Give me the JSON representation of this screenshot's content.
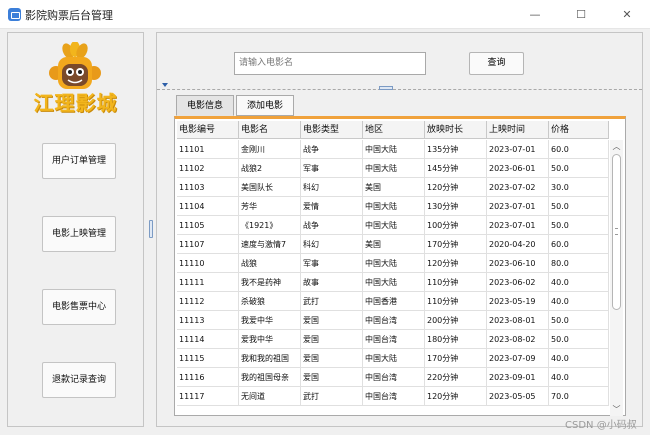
{
  "window": {
    "title": "影院购票后台管理",
    "minimize_glyph": "—",
    "maximize_glyph": "☐",
    "close_glyph": "✕"
  },
  "sidebar": {
    "logo_text": "江理影城",
    "items": [
      {
        "label": "用户订单管理"
      },
      {
        "label": "电影上映管理"
      },
      {
        "label": "电影售票中心"
      },
      {
        "label": "退款记录查询"
      }
    ]
  },
  "search": {
    "placeholder": "请输入电影名",
    "button_label": "查询"
  },
  "tabs": [
    {
      "label": "电影信息"
    },
    {
      "label": "添加电影"
    }
  ],
  "table": {
    "columns": [
      "电影编号",
      "电影名",
      "电影类型",
      "地区",
      "放映时长",
      "上映时间",
      "价格"
    ],
    "rows": [
      [
        "11101",
        "金刚川",
        "战争",
        "中国大陆",
        "135分钟",
        "2023-07-01",
        "60.0"
      ],
      [
        "11102",
        "战狼2",
        "军事",
        "中国大陆",
        "145分钟",
        "2023-06-01",
        "50.0"
      ],
      [
        "11103",
        "美国队长",
        "科幻",
        "美国",
        "120分钟",
        "2023-07-02",
        "30.0"
      ],
      [
        "11104",
        "芳华",
        "爱情",
        "中国大陆",
        "130分钟",
        "2023-07-01",
        "50.0"
      ],
      [
        "11105",
        "《1921》",
        "战争",
        "中国大陆",
        "100分钟",
        "2023-07-01",
        "50.0"
      ],
      [
        "11107",
        "速度与激情7",
        "科幻",
        "美国",
        "170分钟",
        "2020-04-20",
        "60.0"
      ],
      [
        "11110",
        "战狼",
        "军事",
        "中国大陆",
        "120分钟",
        "2023-06-10",
        "80.0"
      ],
      [
        "11111",
        "我不是药神",
        "故事",
        "中国大陆",
        "110分钟",
        "2023-06-02",
        "40.0"
      ],
      [
        "11112",
        "杀破狼",
        "武打",
        "中国香港",
        "110分钟",
        "2023-05-19",
        "40.0"
      ],
      [
        "11113",
        "我爱中华",
        "爱国",
        "中国台湾",
        "200分钟",
        "2023-08-01",
        "50.0"
      ],
      [
        "11114",
        "爱我中华",
        "爱国",
        "中国台湾",
        "180分钟",
        "2023-08-02",
        "50.0"
      ],
      [
        "11115",
        "我和我的祖国",
        "爱国",
        "中国大陆",
        "170分钟",
        "2023-07-09",
        "40.0"
      ],
      [
        "11116",
        "我的祖国母亲",
        "爱国",
        "中国台湾",
        "220分钟",
        "2023-09-01",
        "40.0"
      ],
      [
        "11117",
        "无间道",
        "武打",
        "中国台湾",
        "120分钟",
        "2023-05-05",
        "70.0"
      ]
    ]
  },
  "watermark": "CSDN @小码叔",
  "colors": {
    "logo": "#f2b51c",
    "tab_accent": "#f0a23c",
    "app_icon": "#3c7fd9"
  }
}
